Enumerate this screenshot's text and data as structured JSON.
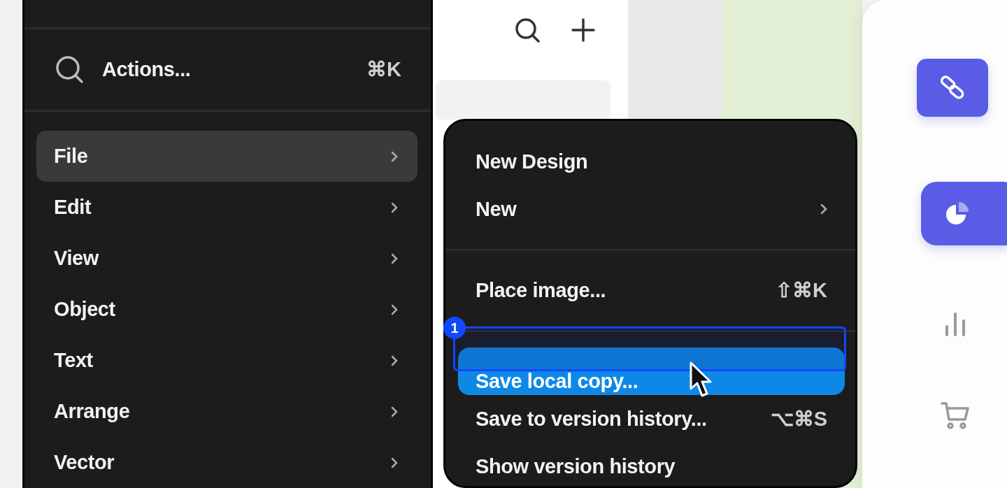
{
  "main_menu": {
    "search": {
      "label": "Actions...",
      "shortcut": "⌘K"
    },
    "items": [
      {
        "label": "File",
        "selected": true,
        "has_submenu": true
      },
      {
        "label": "Edit",
        "selected": false,
        "has_submenu": true
      },
      {
        "label": "View",
        "selected": false,
        "has_submenu": true
      },
      {
        "label": "Object",
        "selected": false,
        "has_submenu": true
      },
      {
        "label": "Text",
        "selected": false,
        "has_submenu": true
      },
      {
        "label": "Arrange",
        "selected": false,
        "has_submenu": true
      },
      {
        "label": "Vector",
        "selected": false,
        "has_submenu": true
      }
    ]
  },
  "submenu": {
    "items": [
      {
        "kind": "item",
        "label": "New Design",
        "selected": false
      },
      {
        "kind": "item",
        "label": "New",
        "selected": false,
        "has_submenu": true
      },
      {
        "kind": "separator"
      },
      {
        "kind": "item",
        "label": "Place image...",
        "shortcut": "⇧⌘K",
        "selected": false
      },
      {
        "kind": "separator"
      },
      {
        "kind": "item",
        "label": "Save local copy...",
        "selected": true
      },
      {
        "kind": "item",
        "label": "Save to version history...",
        "shortcut": "⌥⌘S",
        "selected": false
      },
      {
        "kind": "item",
        "label": "Show version history",
        "selected": false
      }
    ]
  },
  "annotation": {
    "number": "1"
  },
  "sidebar": {
    "buttons": [
      {
        "kind": "link",
        "selected": true
      },
      {
        "kind": "pie",
        "selected": true
      },
      {
        "kind": "bars",
        "selected": false
      },
      {
        "kind": "cart",
        "selected": false
      }
    ]
  }
}
